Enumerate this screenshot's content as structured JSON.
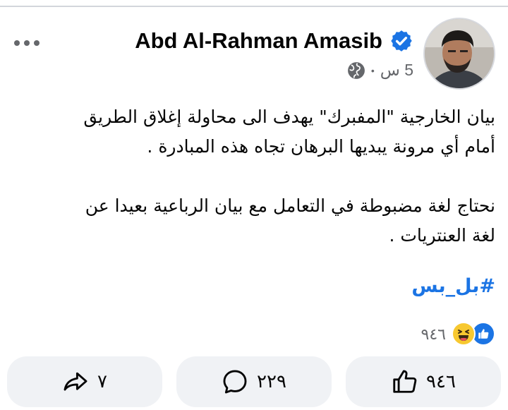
{
  "post": {
    "author": "Abd Al-Rahman Amasib",
    "time": "5 س",
    "text_paragraphs": [
      [
        "بيان الخارجية \"المفبرك\" يهدف الى محاولة إغلاق الطريق",
        "أمام أي مرونة يبديها البرهان تجاه هذه المبادرة ."
      ],
      [
        "نحتاج لغة مضبوطة في التعامل مع بيان الرباعية بعيدا عن",
        "لغة العنتريات ."
      ]
    ],
    "hashtag": "#بل_بس"
  },
  "reactions": {
    "count": "٩٤٦",
    "types": [
      "like",
      "haha"
    ]
  },
  "actions": {
    "share_count": "٧",
    "comment_count": "٢٢٩",
    "like_count": "٩٤٦"
  },
  "colors": {
    "accent": "#1b74e4",
    "secondary_text": "#65676b",
    "button_bg": "#f0f2f5"
  },
  "icons": [
    "more-icon",
    "verified-icon",
    "globe-icon",
    "like-icon",
    "haha-icon",
    "share-icon",
    "comment-icon"
  ]
}
